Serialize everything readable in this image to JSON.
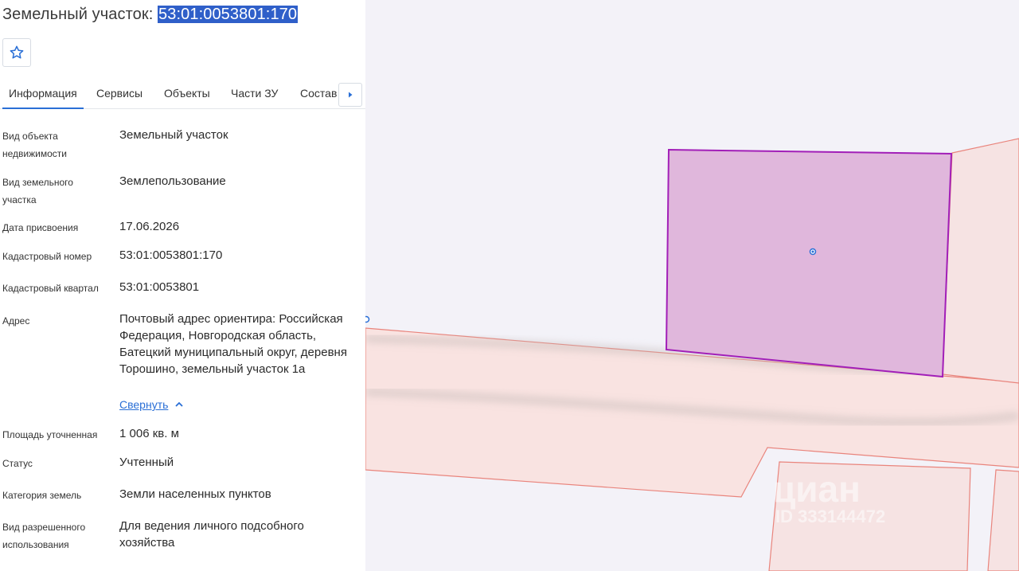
{
  "header": {
    "title_prefix": "Земельный участок:",
    "title_number": "53:01:0053801:170"
  },
  "favorite": {
    "icon": "star-outline-icon"
  },
  "tabs": [
    {
      "label": "Информация",
      "active": true
    },
    {
      "label": "Сервисы"
    },
    {
      "label": "Объекты"
    },
    {
      "label": "Части ЗУ"
    },
    {
      "label": "Состав"
    }
  ],
  "tabs_next_icon": "caret-right-icon",
  "info": {
    "object_type_label": "Вид объекта недвижимости",
    "object_type_value": "Земельный участок",
    "land_type_label": "Вид земельного участка",
    "land_type_value": "Землепользование",
    "date_label": "Дата присвоения",
    "date_value": "17.06.2026",
    "cadastral_number_label": "Кадастровый номер",
    "cadastral_number_value": "53:01:0053801:170",
    "cadastral_block_label": "Кадастровый квартал",
    "cadastral_block_value": "53:01:0053801",
    "address_label": "Адрес",
    "address_value": "Почтовый адрес ориентира: Российская Федерация, Новгородская область, Батецкий муниципальный округ, деревня Торошино, земельный участок 1а",
    "collapse_link": "Свернуть",
    "area_label": "Площадь уточненная",
    "area_value": "1 006 кв. м",
    "status_label": "Статус",
    "status_value": "Учтенный",
    "category_label": "Категория земель",
    "category_value": "Земли населенных пунктов",
    "permitted_use_label": "Вид разрешенного использования",
    "permitted_use_value": "Для ведения личного подсобного хозяйства"
  },
  "map": {
    "selected_parcel_color": "#a21fb8",
    "selected_parcel_fill": "#e0b7dc",
    "neighbor_parcel_color": "#e9847c",
    "neighbor_parcel_fill": "#f6e3e3",
    "watermark_brand": "циан",
    "watermark_id": "ID 333144472"
  }
}
